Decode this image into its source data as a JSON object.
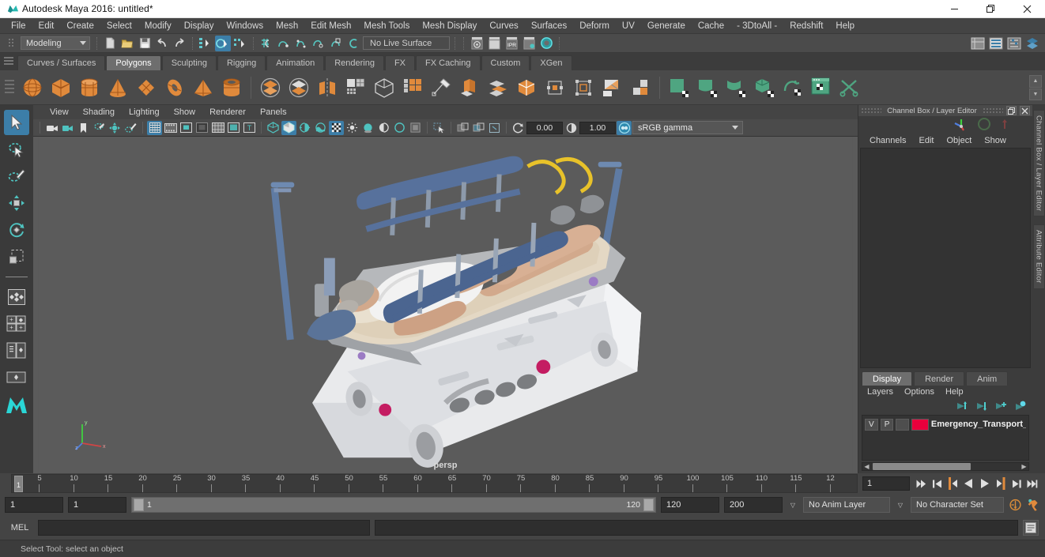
{
  "window": {
    "title": "Autodesk Maya 2016: untitled*",
    "minimize": "—",
    "maximize": "❐",
    "close": "✕"
  },
  "menubar": {
    "items": [
      {
        "label": "File"
      },
      {
        "label": "Edit"
      },
      {
        "label": "Create"
      },
      {
        "label": "Select"
      },
      {
        "label": "Modify"
      },
      {
        "label": "Display"
      },
      {
        "label": "Windows"
      },
      {
        "label": "Mesh"
      },
      {
        "label": "Edit Mesh"
      },
      {
        "label": "Mesh Tools"
      },
      {
        "label": "Mesh Display"
      },
      {
        "label": "Curves"
      },
      {
        "label": "Surfaces"
      },
      {
        "label": "Deform"
      },
      {
        "label": "UV"
      },
      {
        "label": "Generate"
      },
      {
        "label": "Cache"
      },
      {
        "label": "- 3DtoAll -"
      },
      {
        "label": "Redshift"
      },
      {
        "label": "Help"
      }
    ]
  },
  "statusbar": {
    "menuset": "Modeling",
    "live_surface": "No Live Surface",
    "icons": [
      {
        "name": "new-scene-icon"
      },
      {
        "name": "open-scene-icon"
      },
      {
        "name": "save-scene-icon"
      },
      {
        "name": "undo-icon"
      },
      {
        "name": "redo-icon"
      },
      {
        "name": "select-by-hierarchy-icon"
      },
      {
        "name": "select-by-object-icon"
      },
      {
        "name": "select-by-component-icon"
      },
      {
        "name": "snap-to-grid-icon"
      },
      {
        "name": "snap-to-curve-icon"
      },
      {
        "name": "snap-to-point-icon"
      },
      {
        "name": "snap-to-projected-center-icon"
      },
      {
        "name": "snap-to-view-plane-icon"
      },
      {
        "name": "make-live-icon"
      }
    ],
    "right_icons": [
      {
        "name": "show-hide-modeling-toolkit-icon"
      },
      {
        "name": "show-hide-attribute-editor-icon"
      },
      {
        "name": "show-hide-tool-settings-icon"
      },
      {
        "name": "show-hide-channel-box-icon"
      }
    ],
    "render_icons": [
      {
        "name": "render-current-frame-icon"
      },
      {
        "name": "redo-previous-render-icon"
      },
      {
        "name": "ipr-render-icon"
      },
      {
        "name": "render-settings-icon"
      },
      {
        "name": "hypershade-icon"
      }
    ]
  },
  "shelf": {
    "tabs": [
      {
        "label": "Curves / Surfaces",
        "active": false
      },
      {
        "label": "Polygons",
        "active": true
      },
      {
        "label": "Sculpting",
        "active": false
      },
      {
        "label": "Rigging",
        "active": false
      },
      {
        "label": "Animation",
        "active": false
      },
      {
        "label": "Rendering",
        "active": false
      },
      {
        "label": "FX",
        "active": false
      },
      {
        "label": "FX Caching",
        "active": false
      },
      {
        "label": "Custom",
        "active": false
      },
      {
        "label": "XGen",
        "active": false
      }
    ],
    "icons": [
      {
        "name": "poly-sphere-icon"
      },
      {
        "name": "poly-cube-icon"
      },
      {
        "name": "poly-cylinder-icon"
      },
      {
        "name": "poly-cone-icon"
      },
      {
        "name": "poly-plane-icon"
      },
      {
        "name": "poly-torus-icon"
      },
      {
        "name": "poly-pyramid-icon"
      },
      {
        "name": "poly-pipe-icon"
      },
      {
        "name": "poly-boolean-union-icon"
      },
      {
        "name": "poly-boolean-difference-icon"
      },
      {
        "name": "poly-mirror-icon"
      },
      {
        "name": "poly-smooth-icon"
      },
      {
        "name": "poly-combine-icon"
      },
      {
        "name": "poly-multicut-icon"
      },
      {
        "name": "poly-extrude-icon"
      },
      {
        "name": "poly-bevel-icon"
      },
      {
        "name": "poly-bridge-icon"
      },
      {
        "name": "poly-append-icon"
      },
      {
        "name": "poly-wedge-icon"
      },
      {
        "name": "poly-fill-hole-icon"
      },
      {
        "name": "poly-reduce-icon"
      },
      {
        "name": "poly-merge-icon"
      },
      {
        "name": "uv-planar-icon"
      },
      {
        "name": "uv-cylindrical-icon"
      },
      {
        "name": "uv-spherical-icon"
      },
      {
        "name": "uv-automatic-icon"
      },
      {
        "name": "uv-unfold-icon"
      },
      {
        "name": "uv-editor-icon"
      },
      {
        "name": "uv-cut-icon"
      }
    ]
  },
  "toolbox": {
    "tools": [
      {
        "name": "select-tool",
        "active": true
      },
      {
        "name": "lasso-select-tool",
        "active": false
      },
      {
        "name": "paint-select-tool",
        "active": false
      },
      {
        "name": "move-tool",
        "active": false
      },
      {
        "name": "rotate-tool",
        "active": false
      },
      {
        "name": "scale-tool",
        "active": false
      },
      {
        "name": "last-tool-used",
        "active": false
      }
    ],
    "layouts": [
      {
        "name": "single-perspective-layout"
      },
      {
        "name": "four-view-layout"
      },
      {
        "name": "outliner-persp-layout"
      },
      {
        "name": "persp-graph-layout"
      },
      {
        "name": "maya-logo"
      }
    ]
  },
  "viewport": {
    "menus": [
      {
        "label": "View"
      },
      {
        "label": "Shading"
      },
      {
        "label": "Lighting"
      },
      {
        "label": "Show"
      },
      {
        "label": "Renderer"
      },
      {
        "label": "Panels"
      }
    ],
    "camera_label": "persp",
    "exposure": "0.00",
    "gamma": "1.00",
    "color_management": "sRGB gamma",
    "toolbar_icons": [
      {
        "name": "select-camera-icon"
      },
      {
        "name": "camera-attributes-icon"
      },
      {
        "name": "bookmark-icon"
      },
      {
        "name": "image-plane-icon"
      },
      {
        "name": "two-d-pan-zoom-icon"
      },
      {
        "name": "grease-pencil-icon"
      },
      {
        "name": "grid-display-icon",
        "on": true
      },
      {
        "name": "film-gate-icon"
      },
      {
        "name": "resolution-gate-icon"
      },
      {
        "name": "gate-mask-icon"
      },
      {
        "name": "field-chart-icon"
      },
      {
        "name": "safe-action-icon"
      },
      {
        "name": "safe-title-icon"
      },
      {
        "name": "wireframe-icon"
      },
      {
        "name": "smooth-shade-all-icon",
        "on": true
      },
      {
        "name": "shaded-wireframe-icon"
      },
      {
        "name": "textured-icon"
      },
      {
        "name": "use-default-light-icon",
        "on": true
      },
      {
        "name": "shadows-icon"
      },
      {
        "name": "ambient-occlusion-icon"
      },
      {
        "name": "motion-blur-icon"
      },
      {
        "name": "multisample-icon"
      },
      {
        "name": "depth-of-field-icon"
      },
      {
        "name": "isolate-select-icon"
      },
      {
        "name": "xray-icon"
      },
      {
        "name": "xray-joints-icon"
      },
      {
        "name": "xray-active-components-icon"
      },
      {
        "name": "exposure-reset-icon"
      },
      {
        "name": "gamma-reset-icon"
      },
      {
        "name": "color-management-toggle-icon",
        "on": true
      }
    ]
  },
  "channel_box": {
    "panel_title": "Channel Box / Layer Editor",
    "menus": [
      {
        "label": "Channels"
      },
      {
        "label": "Edit"
      },
      {
        "label": "Object"
      },
      {
        "label": "Show"
      }
    ],
    "side_tabs": [
      {
        "label": "Channel Box / Layer Editor"
      },
      {
        "label": "Attribute Editor"
      }
    ]
  },
  "layer_editor": {
    "tabs": [
      {
        "label": "Display",
        "active": true
      },
      {
        "label": "Render",
        "active": false
      },
      {
        "label": "Anim",
        "active": false
      }
    ],
    "menus": [
      {
        "label": "Layers"
      },
      {
        "label": "Options"
      },
      {
        "label": "Help"
      }
    ],
    "buttons": [
      {
        "name": "move-layer-up-icon"
      },
      {
        "name": "move-layer-down-icon"
      },
      {
        "name": "create-new-layer-icon"
      },
      {
        "name": "create-layer-from-selected-icon"
      }
    ],
    "layers": [
      {
        "visibility": "V",
        "playback": "P",
        "state": "",
        "color": "#e8003c",
        "name": "Emergency_Transport_"
      }
    ]
  },
  "timeline": {
    "current_frame": "1",
    "frame_field": "1",
    "ticks": [
      {
        "label": "5"
      },
      {
        "label": "10"
      },
      {
        "label": "15"
      },
      {
        "label": "20"
      },
      {
        "label": "25"
      },
      {
        "label": "30"
      },
      {
        "label": "35"
      },
      {
        "label": "40"
      },
      {
        "label": "45"
      },
      {
        "label": "50"
      },
      {
        "label": "55"
      },
      {
        "label": "60"
      },
      {
        "label": "65"
      },
      {
        "label": "70"
      },
      {
        "label": "75"
      },
      {
        "label": "80"
      },
      {
        "label": "85"
      },
      {
        "label": "90"
      },
      {
        "label": "95"
      },
      {
        "label": "100"
      },
      {
        "label": "105"
      },
      {
        "label": "110"
      },
      {
        "label": "115"
      },
      {
        "label": "12"
      }
    ],
    "playback_buttons": [
      {
        "name": "go-to-start-icon"
      },
      {
        "name": "step-back-frame-icon"
      },
      {
        "name": "step-back-key-icon"
      },
      {
        "name": "play-backwards-icon"
      },
      {
        "name": "play-forwards-icon"
      },
      {
        "name": "step-forward-key-icon"
      },
      {
        "name": "step-forward-frame-icon"
      },
      {
        "name": "go-to-end-icon"
      }
    ]
  },
  "range_slider": {
    "anim_start": "1",
    "range_start": "1",
    "slider_min_label": "1",
    "slider_max_label": "120",
    "range_end": "120",
    "anim_end": "200",
    "anim_layer": "No Anim Layer",
    "character_set": "No Character Set",
    "buttons": [
      {
        "name": "auto-keyframe-toggle-icon"
      },
      {
        "name": "animation-preferences-icon"
      }
    ]
  },
  "command_line": {
    "language_label": "MEL",
    "input_value": "",
    "output_value": "",
    "script-editor-button": "script-editor-icon"
  },
  "help_line": {
    "text": "Select Tool: select an object"
  }
}
